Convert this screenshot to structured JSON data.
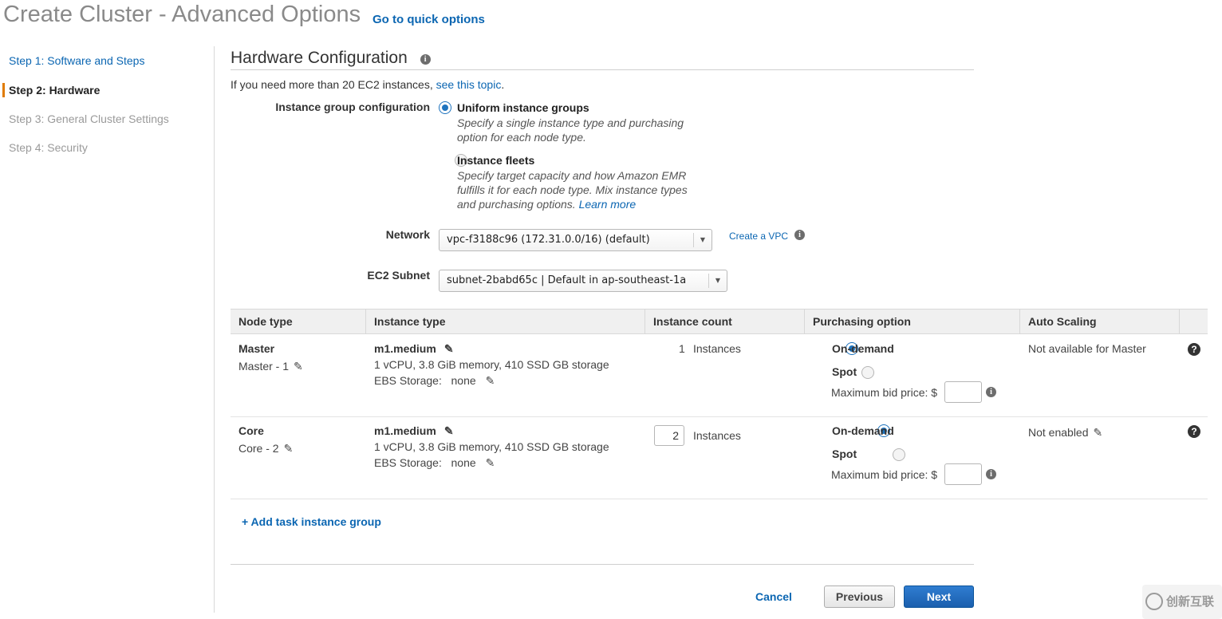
{
  "header": {
    "title": "Create Cluster - Advanced Options",
    "quick_link": "Go to quick options"
  },
  "steps": [
    {
      "label": "Step 1: Software and Steps"
    },
    {
      "label": "Step 2: Hardware"
    },
    {
      "label": "Step 3: General Cluster Settings"
    },
    {
      "label": "Step 4: Security"
    }
  ],
  "hardware": {
    "title": "Hardware Configuration",
    "note_prefix": "If you need more than 20 EC2 instances, ",
    "note_link": "see this topic",
    "note_suffix": ".",
    "instance_group_label": "Instance group configuration",
    "uniform_title": "Uniform instance groups",
    "uniform_desc_1": "Specify a single instance type and purchasing",
    "uniform_desc_2": "option for each node type.",
    "fleets_title": "Instance fleets",
    "fleets_desc_1": "Specify target capacity and how Amazon EMR",
    "fleets_desc_2": "fulfills it for each node type. Mix instance types",
    "fleets_desc_3": "and purchasing options.",
    "fleets_learn_more": "Learn more",
    "network_label": "Network",
    "network_value": "vpc-f3188c96 (172.31.0.0/16) (default)",
    "create_vpc": "Create a VPC",
    "subnet_label": "EC2 Subnet",
    "subnet_value": "subnet-2babd65c | Default in ap-southeast-1a"
  },
  "table": {
    "headers": [
      "Node type",
      "Instance type",
      "Instance count",
      "Purchasing option",
      "Auto Scaling"
    ],
    "rows": [
      {
        "node": "Master",
        "node_name": "Master - 1",
        "instance_type": "m1.medium",
        "specs": "1 vCPU, 3.8 GiB memory, 410 SSD GB storage",
        "ebs_label": "EBS Storage:",
        "ebs_value": "none",
        "count": "1",
        "count_unit": "Instances",
        "on_demand": "On-demand",
        "spot": "Spot",
        "bid_label": "Maximum bid price: $",
        "auto_scaling": "Not available for Master"
      },
      {
        "node": "Core",
        "node_name": "Core - 2",
        "instance_type": "m1.medium",
        "specs": "1 vCPU, 3.8 GiB memory, 410 SSD GB storage",
        "ebs_label": "EBS Storage:",
        "ebs_value": "none",
        "count": "2",
        "count_unit": "Instances",
        "on_demand": "On-demand",
        "spot": "Spot",
        "bid_label": "Maximum bid price: $",
        "auto_scaling": "Not enabled"
      }
    ]
  },
  "add_task": "+ Add task instance group",
  "footer": {
    "cancel": "Cancel",
    "previous": "Previous",
    "next": "Next"
  },
  "watermark": "创新互联",
  "colors": {
    "link": "#0b66b2",
    "active_step_marker": "#e07b00",
    "primary_button": "#1b5fae"
  }
}
